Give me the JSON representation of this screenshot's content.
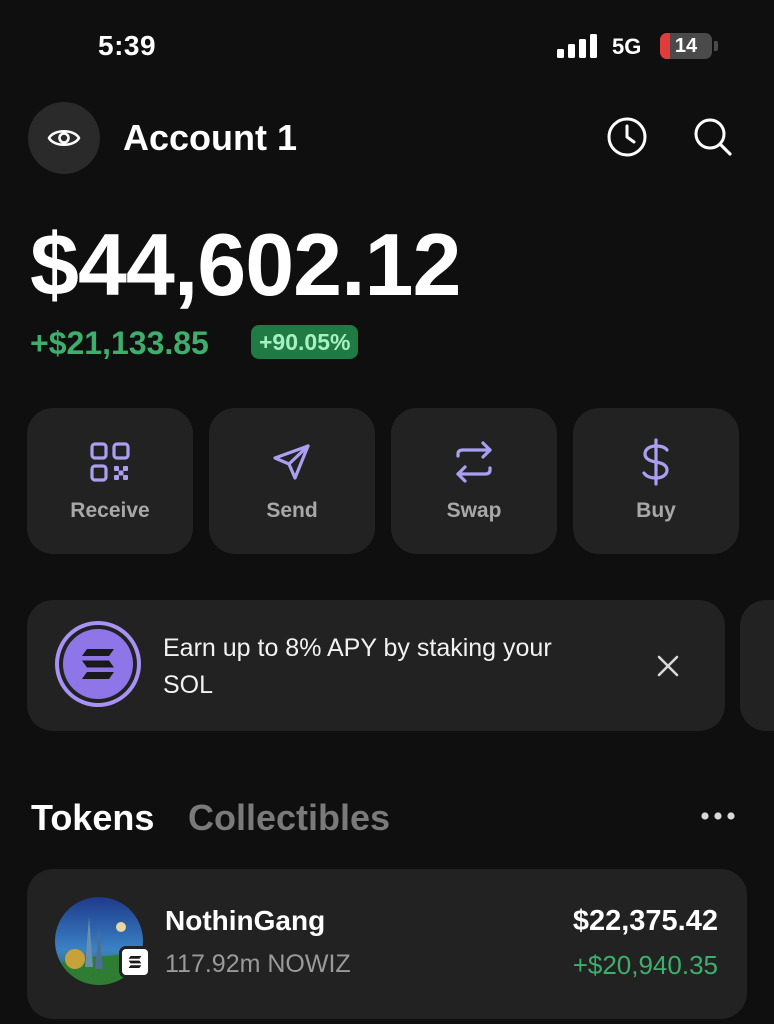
{
  "status_bar": {
    "time": "5:39",
    "network": "5G",
    "battery": "14"
  },
  "header": {
    "account_name": "Account 1",
    "eye_icon": "eye-icon",
    "history_icon": "clock-icon",
    "search_icon": "search-icon"
  },
  "portfolio": {
    "balance": "$44,602.12",
    "change": "+$21,133.85",
    "change_pct": "+90.05%"
  },
  "actions": [
    {
      "label": "Receive",
      "icon": "qr-code-icon"
    },
    {
      "label": "Send",
      "icon": "send-icon"
    },
    {
      "label": "Swap",
      "icon": "swap-icon"
    },
    {
      "label": "Buy",
      "icon": "dollar-icon"
    }
  ],
  "banner": {
    "text": "Earn up to 8% APY by staking your SOL",
    "icon": "solana-icon"
  },
  "tabs": [
    {
      "label": "Tokens",
      "active": true
    },
    {
      "label": "Collectibles",
      "active": false
    }
  ],
  "tokens": [
    {
      "name": "NothinGang",
      "amount": "117.92m NOWIZ",
      "value": "$22,375.42",
      "change": "+$20,940.35"
    }
  ],
  "colors": {
    "accent": "#ab9ff2",
    "positive": "#3dae6b",
    "card": "#222222",
    "background": "#0f0f0f"
  }
}
